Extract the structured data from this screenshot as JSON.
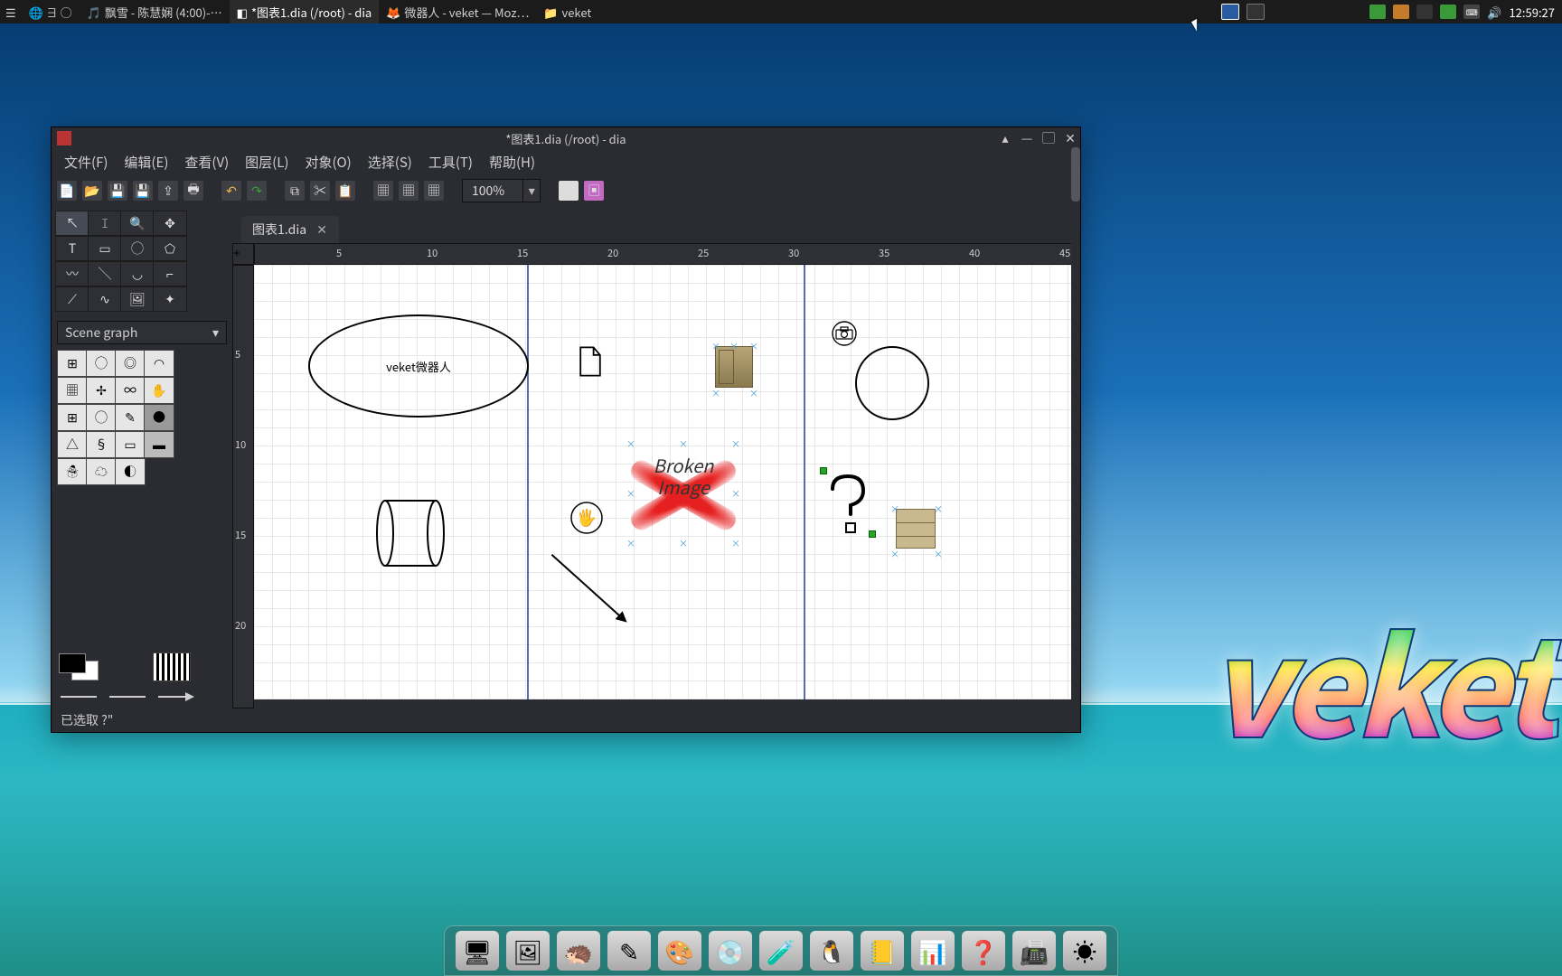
{
  "panel": {
    "tasks": [
      {
        "label": "飘雪 - 陈慧娴 (4:00)-…"
      },
      {
        "label": "*图表1.dia (/root) - dia",
        "active": true
      },
      {
        "label": "微器人 - veket — Moz…"
      },
      {
        "label": "veket"
      }
    ],
    "clock": "12:59:27"
  },
  "window": {
    "title": "*图表1.dia (/root) - dia",
    "menus": [
      "文件(F)",
      "编辑(E)",
      "查看(V)",
      "图层(L)",
      "对象(O)",
      "选择(S)",
      "工具(T)",
      "帮助(H)"
    ],
    "zoom": "100%",
    "tab_label": "图表1.dia",
    "scene_graph_label": "Scene graph",
    "status": "已选取 ?\"",
    "ruler_h": [
      "5",
      "10",
      "15",
      "20",
      "25",
      "30",
      "35",
      "40",
      "45"
    ],
    "ruler_v": [
      "5",
      "10",
      "15",
      "20"
    ]
  },
  "canvas": {
    "ellipse_text": "veket微器人",
    "broken_text_1": "Broken",
    "broken_text_2": "Image"
  },
  "logo": "veket"
}
